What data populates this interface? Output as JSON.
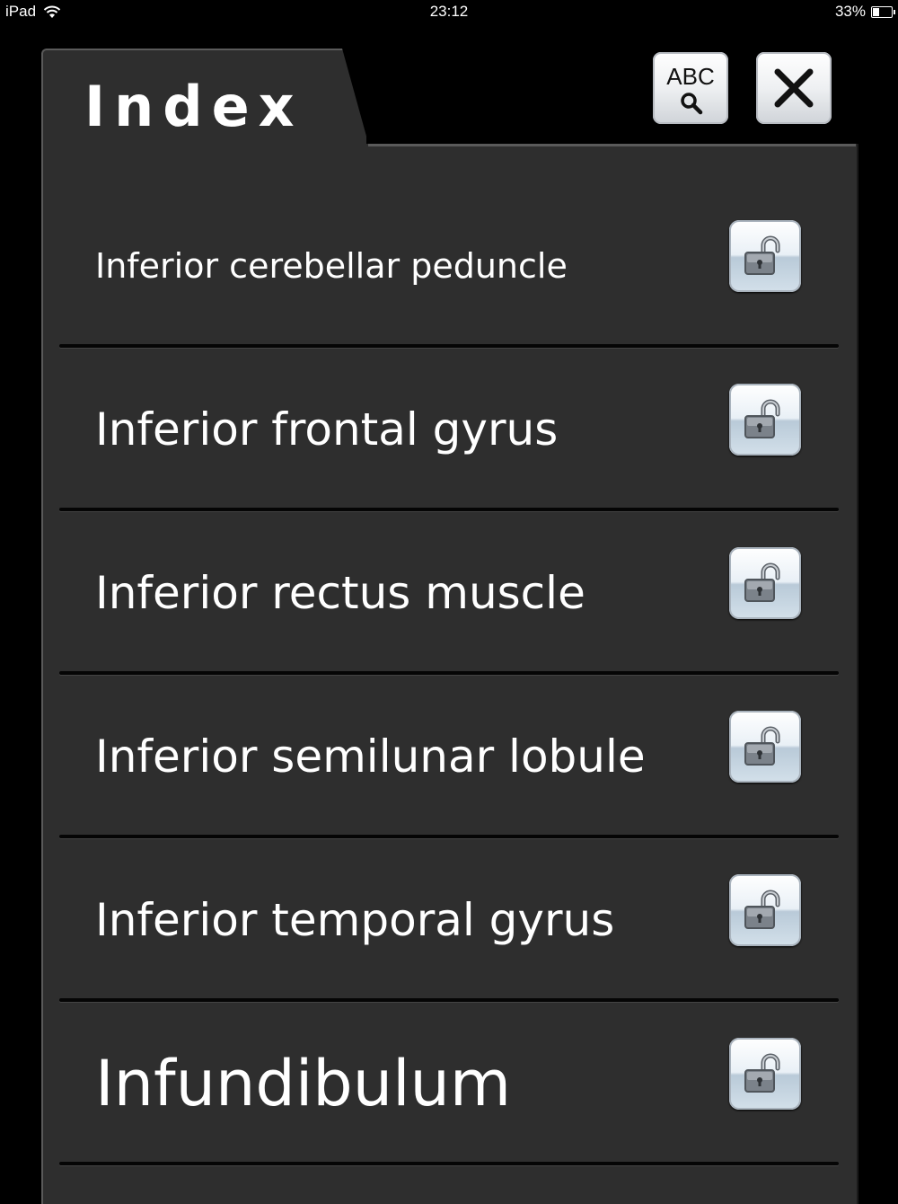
{
  "status_bar": {
    "device": "iPad",
    "time": "23:12",
    "battery_text": "33%",
    "battery_level": 0.33,
    "wifi_icon": "wifi-icon"
  },
  "header": {
    "title": "Index",
    "search_button_label": "ABC",
    "search_icon": "magnifier-icon",
    "close_icon": "close-x-icon"
  },
  "items": [
    {
      "label": "Inferior cerebellar peduncle",
      "lock_icon": "unlocked-padlock-icon"
    },
    {
      "label": "Inferior frontal gyrus",
      "lock_icon": "unlocked-padlock-icon"
    },
    {
      "label": "Inferior rectus muscle",
      "lock_icon": "unlocked-padlock-icon"
    },
    {
      "label": "Inferior semilunar lobule",
      "lock_icon": "unlocked-padlock-icon"
    },
    {
      "label": "Inferior temporal gyrus",
      "lock_icon": "unlocked-padlock-icon"
    },
    {
      "label": "Infundibulum",
      "lock_icon": "unlocked-padlock-icon"
    }
  ]
}
